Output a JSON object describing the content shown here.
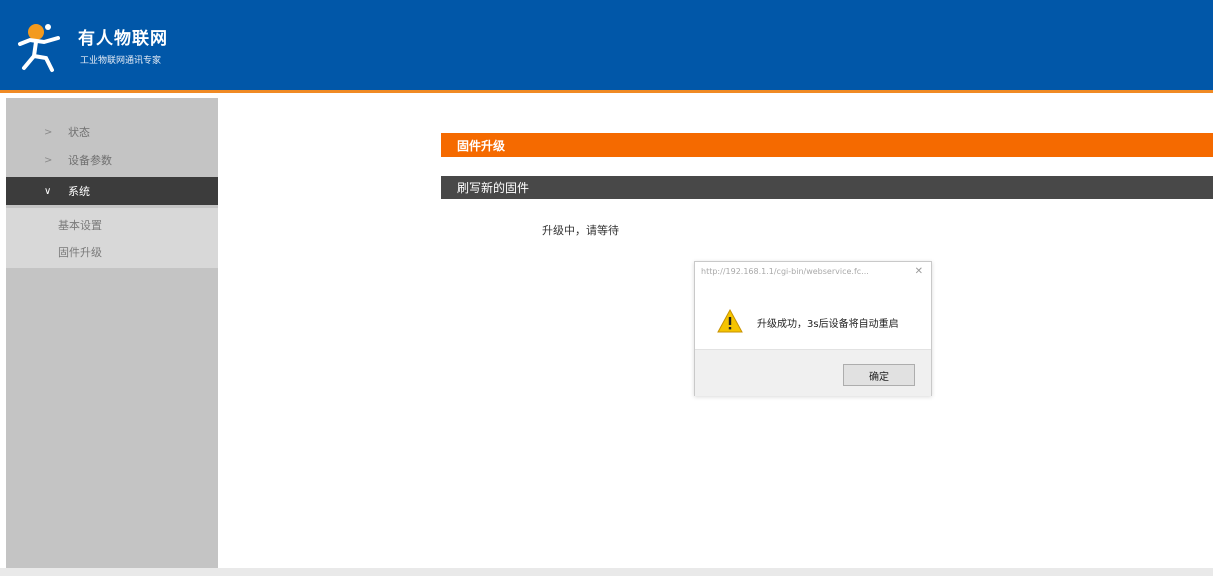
{
  "header": {
    "brand_name": "有人物联网",
    "brand_slogan": "工业物联网通讯专家",
    "logo_icon": "usr-logo-icon",
    "background_color": "#0157a8",
    "accent_color": "#f08a24"
  },
  "sidebar": {
    "items": [
      {
        "label": "状态",
        "icon": "chevron-right-icon",
        "active": false
      },
      {
        "label": "设备参数",
        "icon": "chevron-right-icon",
        "active": false
      },
      {
        "label": "系统",
        "icon": "chevron-down-icon",
        "active": true
      }
    ],
    "subitems": [
      {
        "label": "基本设置"
      },
      {
        "label": "固件升级"
      }
    ]
  },
  "main": {
    "section_title": "固件升级",
    "sub_title": "刷写新的固件",
    "status_text": "升级中，请等待",
    "section_color": "#f56a00"
  },
  "dialog": {
    "title": "http://192.168.1.1/cgi-bin/webservice.fc...",
    "close_icon": "close-icon",
    "warning_icon": "warning-icon",
    "message": "升级成功，3s后设备将自动重启",
    "ok_label": "确定"
  }
}
